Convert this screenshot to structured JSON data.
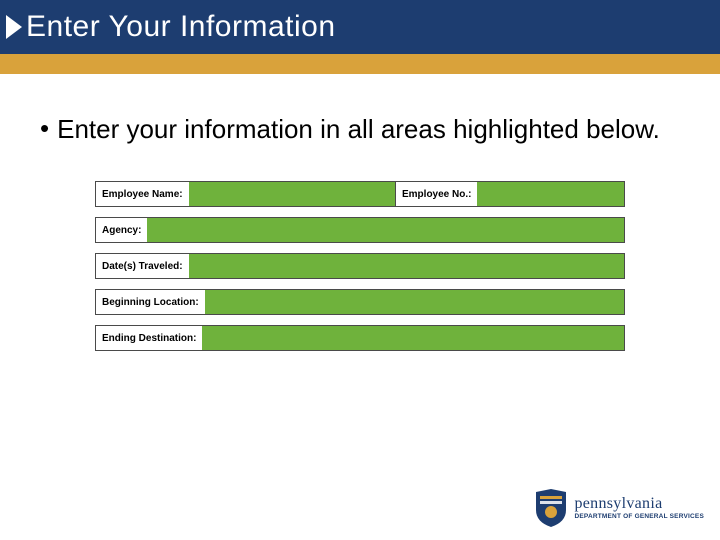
{
  "header": {
    "title": "Enter Your Information"
  },
  "bullet": {
    "text": "Enter your information in all areas highlighted below."
  },
  "form": {
    "employee_name_label": "Employee Name:",
    "employee_no_label": "Employee No.:",
    "agency_label": "Agency:",
    "dates_label": "Date(s) Traveled:",
    "beginning_label": "Beginning Location:",
    "ending_label": "Ending Destination:"
  },
  "footer": {
    "state": "pennsylvania",
    "dept": "DEPARTMENT OF GENERAL SERVICES"
  }
}
